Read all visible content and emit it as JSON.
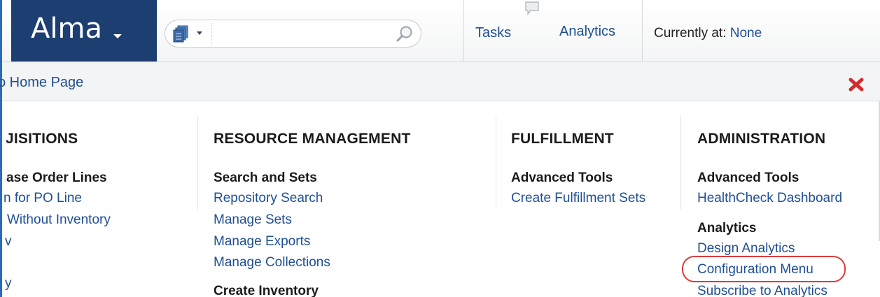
{
  "header": {
    "logo": "Alma",
    "search": {
      "value": "",
      "placeholder": ""
    },
    "tasks": "Tasks",
    "analytics": "Analytics",
    "currently_at_label": "Currently at:",
    "currently_at_value": "None"
  },
  "subbar": {
    "home_link": "o Home Page"
  },
  "menu": {
    "acquisitions": {
      "heading": "JISITIONS",
      "group1_title": "ase Order Lines",
      "items": [
        "n for PO Line",
        "Without Inventory",
        "v",
        "",
        "y"
      ]
    },
    "resource_management": {
      "heading": "RESOURCE MANAGEMENT",
      "group1_title": "Search and Sets",
      "items": [
        "Repository Search",
        "Manage Sets",
        "Manage Exports",
        "Manage Collections"
      ],
      "group2_title": "Create Inventory"
    },
    "fulfillment": {
      "heading": "FULFILLMENT",
      "group1_title": "Advanced Tools",
      "items": [
        "Create Fulfillment Sets"
      ]
    },
    "administration": {
      "heading": "ADMINISTRATION",
      "group1_title": "Advanced Tools",
      "group1_items": [
        "HealthCheck Dashboard"
      ],
      "group2_title": "Analytics",
      "group2_items": [
        "Design Analytics",
        "Configuration Menu",
        "Subscribe to Analytics"
      ]
    }
  },
  "colors": {
    "logo_bg": "#1d3e70",
    "link": "#1f4f93",
    "highlight": "#e03a3a",
    "close": "#d42b2b"
  }
}
